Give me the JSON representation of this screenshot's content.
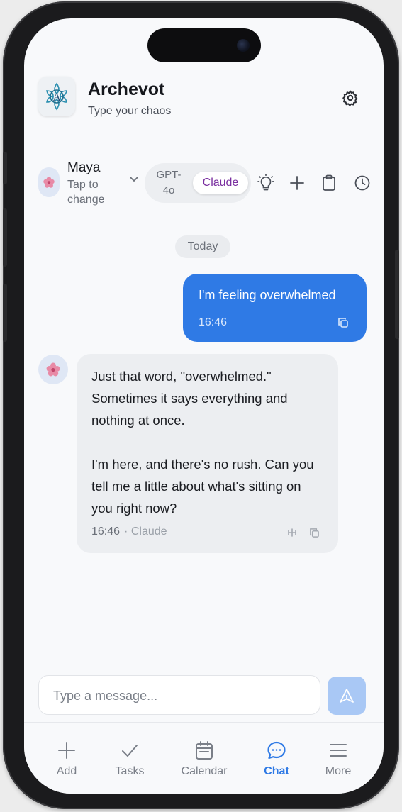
{
  "app": {
    "title": "Archevot",
    "subtitle": "Type your chaos"
  },
  "persona": {
    "name": "Maya",
    "hint": "Tap to change"
  },
  "models": {
    "option_a": "GPT-4o",
    "option_b": "Claude",
    "selected": "Claude"
  },
  "chat": {
    "date_divider": "Today",
    "messages": [
      {
        "role": "user",
        "text": "I'm feeling overwhelmed",
        "time": "16:46"
      },
      {
        "role": "assistant",
        "paragraphs": [
          "Just that word, \"overwhelmed.\" Sometimes it says everything and nothing at once.",
          "I'm here, and there's no rush. Can you tell me a little about what's sitting on you right now?"
        ],
        "time": "16:46",
        "model": "Claude"
      }
    ]
  },
  "composer": {
    "placeholder": "Type a message...",
    "value": ""
  },
  "nav": {
    "items": [
      {
        "label": "Add",
        "icon": "plus-icon"
      },
      {
        "label": "Tasks",
        "icon": "check-icon"
      },
      {
        "label": "Calendar",
        "icon": "calendar-icon"
      },
      {
        "label": "Chat",
        "icon": "chat-bubble-icon",
        "active": true
      },
      {
        "label": "More",
        "icon": "menu-icon"
      }
    ]
  },
  "colors": {
    "accent": "#2f7ae5",
    "claude_label": "#7a2fa0",
    "send_button": "#a9c8f5",
    "assistant_bubble": "#eceef1"
  }
}
